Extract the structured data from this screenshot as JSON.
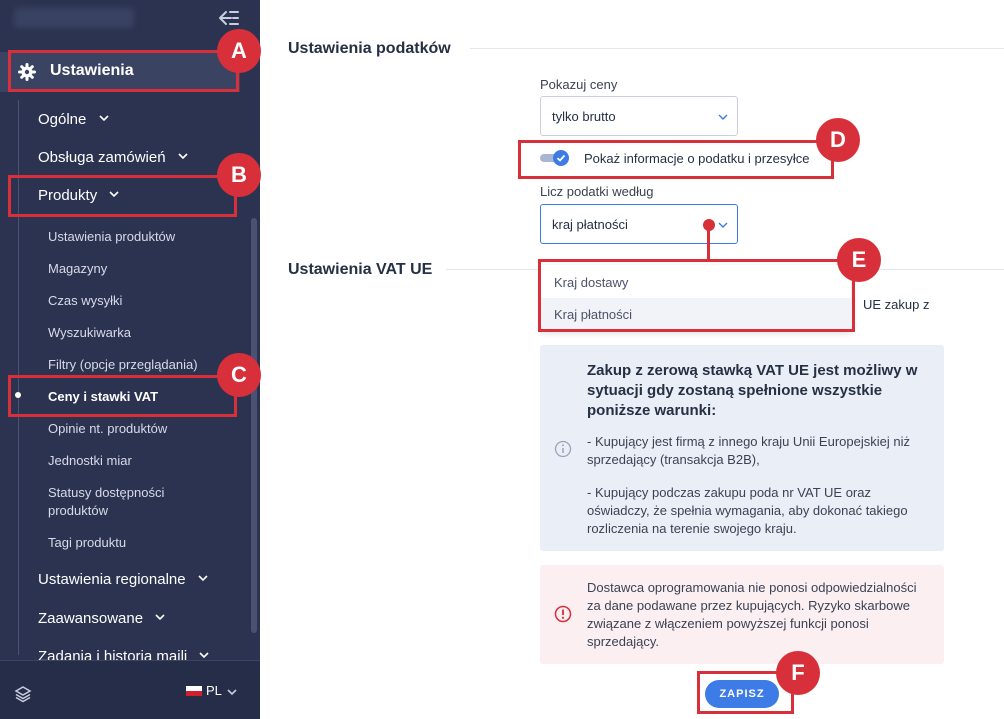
{
  "sidebar": {
    "settings_label": "Ustawienia",
    "items": [
      {
        "label": "Ogólne"
      },
      {
        "label": "Obsługa zamówień"
      },
      {
        "label": "Produkty"
      }
    ],
    "sub_items": [
      {
        "label": "Ustawienia produktów"
      },
      {
        "label": "Magazyny"
      },
      {
        "label": "Czas wysyłki"
      },
      {
        "label": "Wyszukiwarka"
      },
      {
        "label": "Filtry (opcje przeglądania)"
      },
      {
        "label": "Ceny i stawki VAT"
      },
      {
        "label": "Opinie nt. produktów"
      },
      {
        "label": "Jednostki miar"
      },
      {
        "label": "Statusy dostępności produktów"
      },
      {
        "label": "Tagi produktu"
      }
    ],
    "bottom_items": [
      {
        "label": "Ustawienia regionalne"
      },
      {
        "label": "Zaawansowane"
      },
      {
        "label": "Zadania i historia maili"
      }
    ],
    "language": "PL"
  },
  "main": {
    "tax_section_title": "Ustawienia podatków",
    "show_prices_label": "Pokazuj ceny",
    "show_prices_value": "tylko brutto",
    "toggle_label": "Pokaż informacje o podatku i przesyłce",
    "calc_taxes_label": "Licz podatki według",
    "calc_taxes_value": "kraj płatności",
    "dropdown_options": [
      "Kraj dostawy",
      "Kraj płatności"
    ],
    "vat_section_title": "Ustawienia VAT UE",
    "partial_text": "UE zakup z",
    "info_title": "Zakup z zerową stawką VAT UE jest możliwy w sytuacji gdy zostaną spełnione wszystkie poniższe warunki:",
    "info_p1": "- Kupujący jest firmą z innego kraju Unii Europejskiej niż sprzedający (transakcja B2B),",
    "info_p2": "- Kupujący podczas zakupu poda nr VAT UE oraz oświadczy, że spełnia wymagania, aby dokonać takiego rozliczenia na terenie swojego kraju.",
    "warn_text": "Dostawca oprogramowania nie ponosi odpowiedzialności za dane podawane przez kupujących. Ryzyko skarbowe związane z włączeniem powyższej funkcji ponosi sprzedający.",
    "save_label": "ZAPISZ"
  },
  "annotations": [
    "A",
    "B",
    "C",
    "D",
    "E",
    "F"
  ],
  "colors": {
    "sidebar_bg": "#2b3350",
    "accent": "#3d7ce6",
    "annotation": "#d8303a",
    "info_bg": "#eaeef7",
    "warn_bg": "#fbeff2"
  }
}
